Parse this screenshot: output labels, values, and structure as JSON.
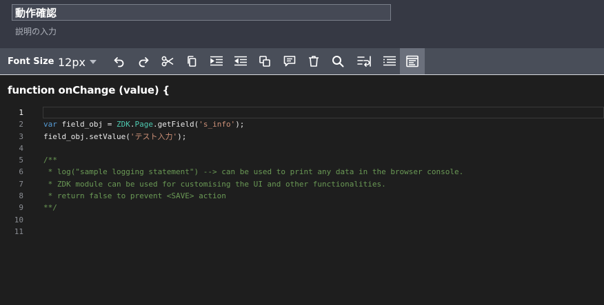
{
  "form": {
    "title_value": "動作確認",
    "description_placeholder": "説明の入力"
  },
  "toolbar": {
    "font_size_label": "Font Size",
    "font_size_value": "12px",
    "buttons": [
      "undo-icon",
      "redo-icon",
      "cut-icon",
      "copy-icon",
      "indent-icon",
      "outdent-icon",
      "duplicate-icon",
      "comment-icon",
      "delete-icon",
      "search-icon",
      "wrap-icon",
      "format-icon",
      "snippet-icon"
    ]
  },
  "editor": {
    "function_header": "function onChange (value) {",
    "line_numbers": [
      "1",
      "2",
      "3",
      "4",
      "5",
      "6",
      "7",
      "8",
      "9",
      "10",
      "11"
    ],
    "code": {
      "l2_var": "var",
      "l2_a": " field_obj = ",
      "l2_zdk": "ZDK",
      "l2_dot": ".",
      "l2_page": "Page",
      "l2_b": ".getField(",
      "l2_str": "'s_info'",
      "l2_c": ");",
      "l3_a": "field_obj.setValue(",
      "l3_str": "'テスト入力'",
      "l3_c": ");",
      "l5": "/**",
      "l6": " * log(\"sample logging statement\") --> can be used to print any data in the browser console.",
      "l7": " * ZDK module can be used for customising the UI and other functionalities.",
      "l8": " * return false to prevent <SAVE> action",
      "l9": "**/"
    }
  },
  "colors": {
    "header_bg": "#363944",
    "toolbar_bg": "#494e59",
    "editor_bg": "#1e1e1e",
    "keyword": "#569cd6",
    "string": "#ce9178",
    "comment": "#6a9955"
  }
}
